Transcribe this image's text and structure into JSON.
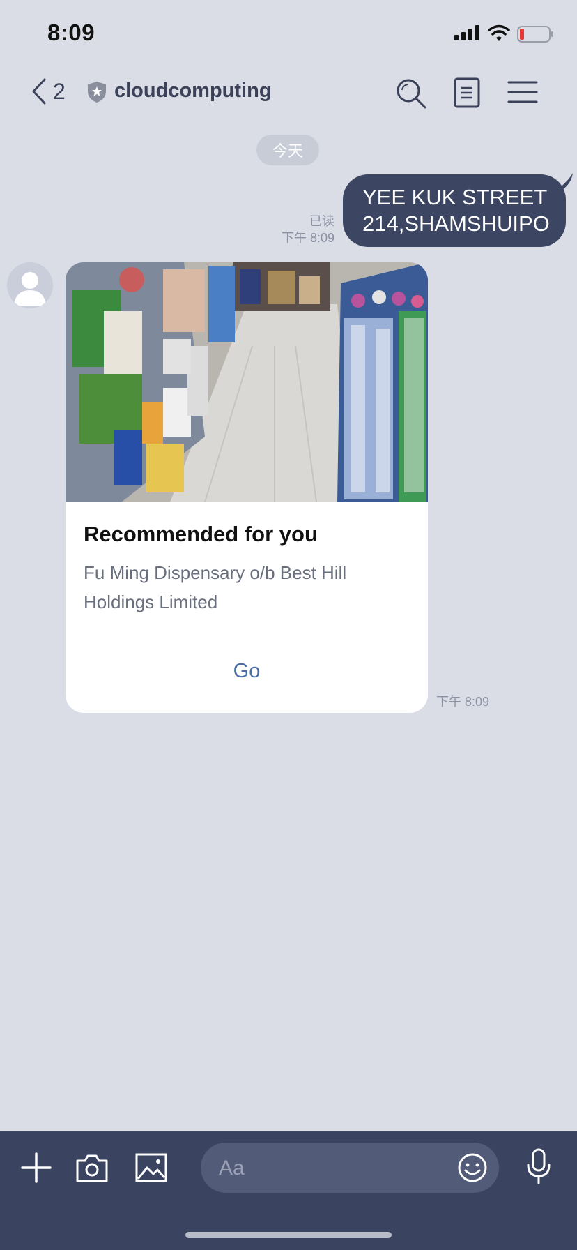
{
  "status_bar": {
    "time": "8:09",
    "battery_level": 0.12,
    "battery_color": "#e53935"
  },
  "header": {
    "back_count": "2",
    "title": "cloudcomputing",
    "icons": [
      "back-chevron-icon",
      "shield-icon",
      "search-icon",
      "notes-icon",
      "menu-icon"
    ]
  },
  "date_divider": "今天",
  "messages": [
    {
      "direction": "outgoing",
      "text_line1": "YEE KUK STREET",
      "text_line2": "214,SHAMSHUIPO",
      "read_status": "已读",
      "time": "下午 8:09",
      "bubble_color": "#3c4662"
    },
    {
      "direction": "incoming",
      "card": {
        "title": "Recommended for you",
        "description": "Fu Ming Dispensary o/b Best Hill Holdings Limited",
        "action_label": "Go"
      },
      "time": "下午 8:09"
    }
  ],
  "composer": {
    "placeholder": "Aa",
    "icons": [
      "plus-icon",
      "camera-icon",
      "image-icon",
      "emoji-icon",
      "microphone-icon"
    ]
  },
  "colors": {
    "background": "#dadde6",
    "bar": "#3a4360",
    "link": "#4b6ea8"
  }
}
